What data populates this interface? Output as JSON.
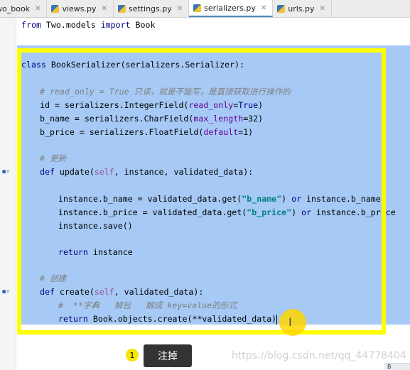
{
  "tabs": [
    {
      "label": "wo_book",
      "active": false
    },
    {
      "label": "views.py",
      "active": false
    },
    {
      "label": "settings.py",
      "active": false
    },
    {
      "label": "serializers.py",
      "active": true
    },
    {
      "label": "urls.py",
      "active": false
    }
  ],
  "code": {
    "l1": {
      "a": "from",
      "b": " Two.models ",
      "c": "import",
      "d": " Book"
    },
    "l2": {
      "a": "class",
      "b": " BookSerializer(serializers.Serializer):"
    },
    "l3": "# read_only = True 只读，就是不能写，是直接获取进行操作的",
    "l4": {
      "a": "id = serializers.IntegerField(",
      "b": "read_only",
      "c": "=",
      "d": "True",
      "e": ")"
    },
    "l5": {
      "a": "b_name = serializers.CharField(",
      "b": "max_length",
      "c": "=32)"
    },
    "l6": {
      "a": "b_price = serializers.FloatField(",
      "b": "default",
      "c": "=1)"
    },
    "l7": "# 更新",
    "l8": {
      "a": "def",
      "b": " update(",
      "c": "self",
      "d": ", instance, validated_data):"
    },
    "l9": {
      "a": "instance.b_name = validated_data.get(",
      "b": "\"b_name\"",
      "c": ") ",
      "d": "or",
      "e": " instance.b_name"
    },
    "l10": {
      "a": "instance.b_price = validated_data.get(",
      "b": "\"b_price\"",
      "c": ") ",
      "d": "or",
      "e": " instance.b_price"
    },
    "l11": "instance.save()",
    "l12": {
      "a": "return",
      "b": " instance"
    },
    "l13": "# 创建",
    "l14": {
      "a": "def",
      "b": " create(",
      "c": "self",
      "d": ", validated_data):"
    },
    "l15": "#  **字典   解包   解成 key=value的形式",
    "l16": {
      "a": "return",
      "b": " Book.objects.create(**validated_data)"
    }
  },
  "annotation": {
    "step": "1",
    "tooltip": "注掉"
  },
  "watermark": "https://blog.csdn.net/qq_44778404",
  "corner_label": "B",
  "colors": {
    "selection": "#a6c9f5",
    "highlight_box": "#ffff00",
    "tooltip_bg": "#333333"
  }
}
